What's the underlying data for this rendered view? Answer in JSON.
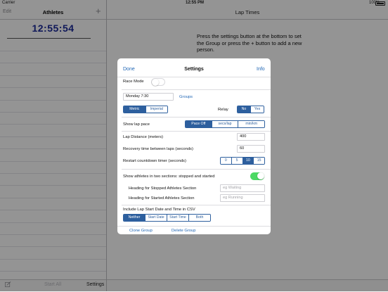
{
  "status": {
    "carrier": "Carrier",
    "time": "12:55 PM",
    "battery": "100%"
  },
  "left": {
    "edit": "Edit",
    "title": "Athletes",
    "add": "+",
    "clock": "12:55:54",
    "bottom": {
      "start_all": "Start All",
      "settings": "Settings"
    }
  },
  "right": {
    "title": "Lap Times",
    "instructions": "Press the settings button at the bottom to set the Group or press the + button to add a new person."
  },
  "settings": {
    "done": "Done",
    "title": "Settings",
    "info": "Info",
    "race_mode": {
      "label": "Race Mode",
      "on": false
    },
    "group": {
      "value": "Monday 7:30",
      "link": "Groups"
    },
    "units": {
      "options": [
        "Metric",
        "Imperial"
      ],
      "selected": "Metric"
    },
    "relay": {
      "label": "Relay",
      "options": [
        "No",
        "Yes"
      ],
      "selected": "No"
    },
    "lap_pace": {
      "label": "Show lap pace",
      "options": [
        "Pace Off",
        "secs/lap",
        "min/km"
      ],
      "selected": "Pace Off"
    },
    "lap_distance": {
      "label": "Lap Distance (meters)",
      "value": "400"
    },
    "recovery": {
      "label": "Recovery time between laps (seconds)",
      "value": "60"
    },
    "restart": {
      "label": "Restart countdown timer (seconds)",
      "options": [
        "0",
        "5",
        "10",
        "15"
      ],
      "selected": "10"
    },
    "two_sections": {
      "label": "Show athletes in two sections: stopped and started",
      "on": true
    },
    "stopped_heading": {
      "label": "Heading for Stopped Athletes Section",
      "placeholder": "eg Waiting"
    },
    "started_heading": {
      "label": "Heading for Started Athletes Section",
      "placeholder": "eg Running"
    },
    "csv": {
      "label": "Include Lap Start Date and Time in CSV",
      "options": [
        "Neither",
        "Start Date",
        "Start Time",
        "Both"
      ],
      "selected": "Neither"
    },
    "clone_group": "Clone Group",
    "delete_group": "Delete Group"
  },
  "colors": {
    "accent": "#2d5f9e",
    "clock": "#1b2a9a",
    "toggle_on": "#4cd964"
  }
}
